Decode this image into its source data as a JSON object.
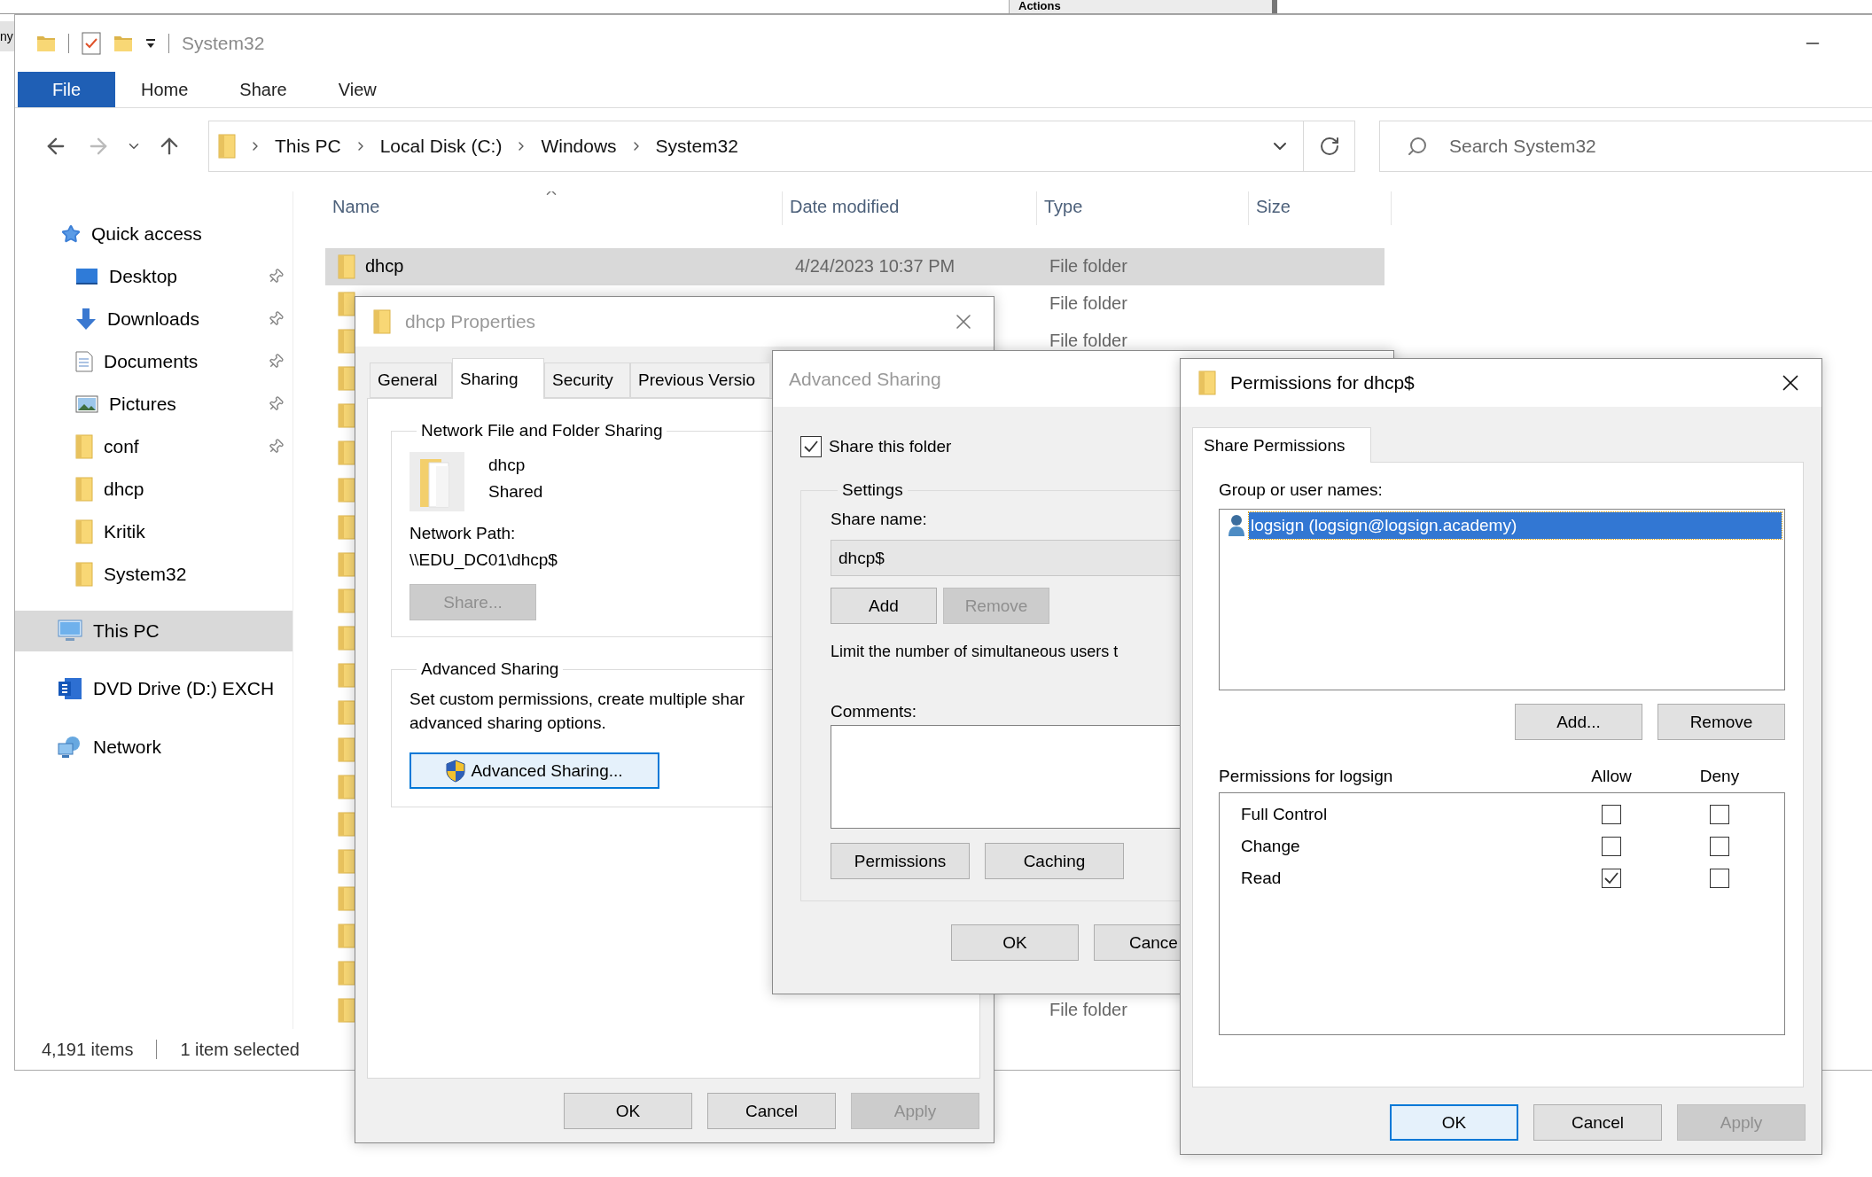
{
  "background_windows": [
    {
      "label": "ny"
    },
    {
      "label": "Actions"
    }
  ],
  "explorer": {
    "title": "System32",
    "ribbon_tabs": [
      {
        "label": "File",
        "selected": true
      },
      {
        "label": "Home",
        "selected": false
      },
      {
        "label": "Share",
        "selected": false
      },
      {
        "label": "View",
        "selected": false
      }
    ],
    "breadcrumb": [
      "This PC",
      "Local Disk (C:)",
      "Windows",
      "System32"
    ],
    "search": {
      "placeholder": "Search System32"
    },
    "sidebar": [
      {
        "label": "Quick access",
        "kind": "star",
        "selected": false,
        "children": [
          {
            "label": "Desktop",
            "kind": "desktop",
            "pinned": true,
            "selected": false
          },
          {
            "label": "Downloads",
            "kind": "downloads",
            "pinned": true,
            "selected": false
          },
          {
            "label": "Documents",
            "kind": "documents",
            "pinned": true,
            "selected": false
          },
          {
            "label": "Pictures",
            "kind": "pictures",
            "pinned": true,
            "selected": false
          },
          {
            "label": "conf",
            "kind": "folder",
            "pinned": true,
            "selected": false
          },
          {
            "label": "dhcp",
            "kind": "folder",
            "pinned": false,
            "selected": false
          },
          {
            "label": "Kritik",
            "kind": "folder",
            "pinned": false,
            "selected": false
          },
          {
            "label": "System32",
            "kind": "folder",
            "pinned": false,
            "selected": false
          }
        ]
      },
      {
        "label": "This PC",
        "kind": "pc",
        "selected": true
      },
      {
        "label": "DVD Drive (D:) EXCH",
        "kind": "dvd",
        "selected": false
      },
      {
        "label": "Network",
        "kind": "network",
        "selected": false
      }
    ],
    "columns": [
      "Name",
      "Date modified",
      "Type",
      "Size"
    ],
    "rows": [
      {
        "name": "dhcp",
        "date": "4/24/2023 10:37 PM",
        "type": "File folder",
        "selected": true
      },
      {
        "type": "File folder",
        "selected": false
      },
      {
        "type": "File folder",
        "selected": false
      },
      {
        "selected": false
      },
      {
        "selected": false
      },
      {
        "selected": false
      },
      {
        "selected": false
      },
      {
        "selected": false
      },
      {
        "selected": false
      },
      {
        "selected": false
      },
      {
        "selected": false
      },
      {
        "selected": false
      },
      {
        "selected": false
      },
      {
        "selected": false
      },
      {
        "selected": false
      },
      {
        "selected": false
      },
      {
        "selected": false
      },
      {
        "selected": false
      },
      {
        "selected": false
      },
      {
        "selected": false
      },
      {
        "type": "File folder",
        "selected": false
      }
    ],
    "status_bar": {
      "items": "4,191 items",
      "selection": "1 item selected"
    }
  },
  "properties_dialog": {
    "title": "dhcp Properties",
    "active": false,
    "tabs": [
      {
        "label": "General",
        "selected": false
      },
      {
        "label": "Sharing",
        "selected": true
      },
      {
        "label": "Security",
        "selected": false
      },
      {
        "label": "Previous Versio",
        "selected": false
      }
    ],
    "network_group": {
      "title": "Network File and Folder Sharing",
      "name": "dhcp",
      "status": "Shared",
      "path_label": "Network Path:",
      "path": "\\\\EDU_DC01\\dhcp$",
      "share_button": {
        "label": "Share...",
        "disabled": true
      }
    },
    "advanced_group": {
      "title": "Advanced Sharing",
      "description": "Set custom permissions, create multiple shar\nadvanced sharing options.",
      "button": {
        "label": "Advanced Sharing...",
        "focused": true
      }
    },
    "buttons": [
      {
        "label": "OK",
        "disabled": false
      },
      {
        "label": "Cancel",
        "disabled": false
      },
      {
        "label": "Apply",
        "disabled": true
      }
    ]
  },
  "advanced_sharing": {
    "title": "Advanced Sharing",
    "active": false,
    "share_folder": {
      "label": "Share this folder",
      "checked": true
    },
    "settings_title": "Settings",
    "share_name_label": "Share name:",
    "share_name": "dhcp$",
    "name_buttons": [
      {
        "label": "Add",
        "disabled": false
      },
      {
        "label": "Remove",
        "disabled": true
      }
    ],
    "limit_text": "Limit the number of simultaneous users t",
    "comments_label": "Comments:",
    "settings_buttons": [
      {
        "label": "Permissions",
        "disabled": false
      },
      {
        "label": "Caching",
        "disabled": false
      }
    ],
    "buttons": [
      {
        "label": "OK",
        "disabled": false
      },
      {
        "label": "Cance",
        "disabled": false
      }
    ]
  },
  "permissions_dialog": {
    "title": "Permissions for dhcp$",
    "active": true,
    "tab": {
      "label": "Share Permissions",
      "selected": true
    },
    "users_label": "Group or user names:",
    "users": [
      {
        "name": "logsign (logsign@logsign.academy)",
        "selected": true
      }
    ],
    "user_buttons": [
      {
        "label": "Add...",
        "disabled": false
      },
      {
        "label": "Remove",
        "disabled": false
      }
    ],
    "permissions_label": "Permissions for logsign",
    "allow_label": "Allow",
    "deny_label": "Deny",
    "permissions": [
      {
        "name": "Full Control",
        "allow": false,
        "deny": false
      },
      {
        "name": "Change",
        "allow": false,
        "deny": false
      },
      {
        "name": "Read",
        "allow": true,
        "deny": false
      }
    ],
    "buttons": [
      {
        "label": "OK",
        "disabled": false,
        "focused": true
      },
      {
        "label": "Cancel",
        "disabled": false,
        "focused": false
      },
      {
        "label": "Apply",
        "disabled": true,
        "focused": false
      }
    ]
  }
}
